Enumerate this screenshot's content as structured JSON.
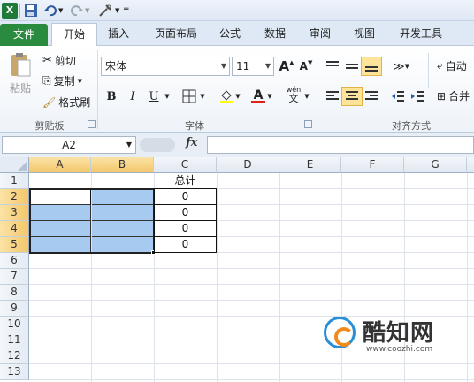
{
  "qat": {
    "logo": "X"
  },
  "tabs": [
    "文件",
    "开始",
    "插入",
    "页面布局",
    "公式",
    "数据",
    "审阅",
    "视图",
    "开发工具"
  ],
  "ribbon": {
    "clipboard": {
      "paste": "粘贴",
      "cut": "剪切",
      "copy": "复制",
      "format_painter": "格式刷",
      "label": "剪贴板"
    },
    "font": {
      "name": "宋体",
      "size": "11",
      "label": "字体",
      "bold": "B",
      "italic": "I",
      "underline": "U",
      "grow": "A",
      "shrink": "A",
      "font_color": "A"
    },
    "alignment": {
      "wrap": "自动",
      "merge": "合并",
      "label": "对齐方式"
    }
  },
  "formula_bar": {
    "name_box": "A2",
    "fx": "fx",
    "formula": ""
  },
  "sheet": {
    "columns": [
      "A",
      "B",
      "C",
      "D",
      "E",
      "F",
      "G"
    ],
    "rows": [
      "1",
      "2",
      "3",
      "4",
      "5",
      "6",
      "7",
      "8",
      "9",
      "10",
      "11",
      "12",
      "13"
    ],
    "c1": "总计",
    "c_values": [
      "0",
      "0",
      "0",
      "0"
    ]
  },
  "watermark": {
    "title": "酷知网",
    "url": "www.coozhi.com"
  },
  "colors": {
    "file_tab": "#2a8a3e",
    "selection": "#a6caf0",
    "header_selected": "#f3c76b"
  }
}
